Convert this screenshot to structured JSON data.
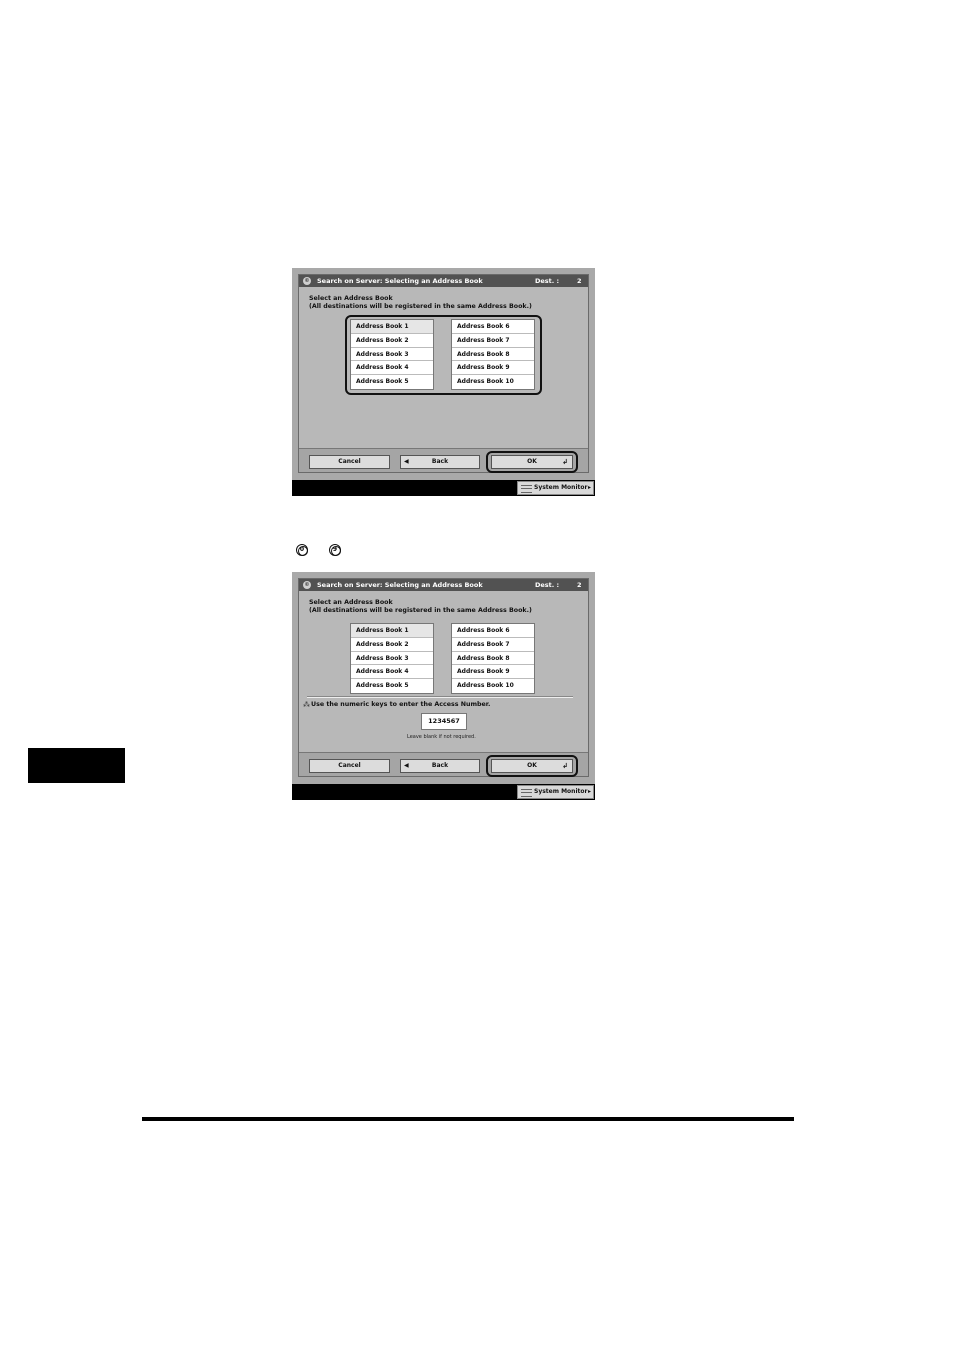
{
  "screens": [
    {
      "title": "Search on Server: Selecting an Address Book",
      "dest_label": "Dest. :",
      "dest_value": "2",
      "instruction_line1": "Select an Address Book",
      "instruction_line2": "(All destinations will be registered in the same Address Book.)",
      "left_list": [
        "Address Book 1",
        "Address Book 2",
        "Address Book 3",
        "Address Book 4",
        "Address Book 5"
      ],
      "right_list": [
        "Address Book 6",
        "Address Book 7",
        "Address Book 8",
        "Address Book 9",
        "Address Book 10"
      ],
      "cancel": "Cancel",
      "back": "Back",
      "ok": "OK",
      "system_monitor": "System Monitor"
    },
    {
      "title": "Search on Server: Selecting an Address Book",
      "dest_label": "Dest. :",
      "dest_value": "2",
      "instruction_line1": "Select an Address Book",
      "instruction_line2": "(All destinations will be registered in the same Address Book.)",
      "left_list": [
        "Address Book 1",
        "Address Book 2",
        "Address Book 3",
        "Address Book 4",
        "Address Book 5"
      ],
      "right_list": [
        "Address Book 6",
        "Address Book 7",
        "Address Book 8",
        "Address Book 9",
        "Address Book 10"
      ],
      "access_prompt": "Use the numeric keys to enter the Access Number.",
      "access_value": "1234567",
      "access_note": "Leave blank if not required.",
      "cancel": "Cancel",
      "back": "Back",
      "ok": "OK",
      "system_monitor": "System Monitor"
    }
  ],
  "keys": [
    "0",
    "9"
  ]
}
